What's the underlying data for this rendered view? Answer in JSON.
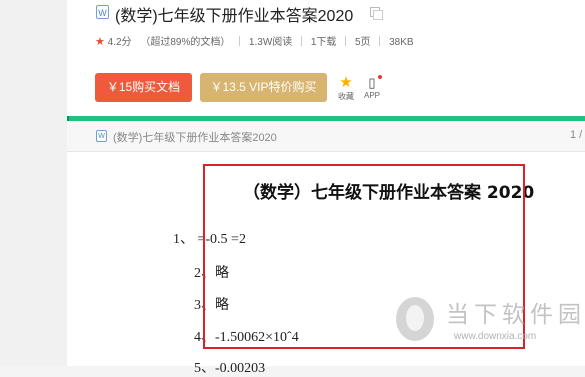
{
  "doc": {
    "icon_label": "W",
    "title": "(数学)七年级下册作业本答案2020",
    "rating": "4.2分",
    "beat": "（超过89%的文档）",
    "reads": "1.3W阅读",
    "downloads": "1下载",
    "pages": "5页",
    "size": "38KB"
  },
  "actions": {
    "buy_label": "￥15购买文档",
    "vip_label": "￥13.5 VIP特价购买",
    "fav_label": "收藏",
    "app_label": "APP"
  },
  "viewer": {
    "header_title": "(数学)七年级下册作业本答案2020",
    "page_num": "1 /"
  },
  "content": {
    "title": "（数学）七年级下册作业本答案 2020",
    "lines": [
      "1、 =-0.5 =2",
      "2、略",
      "3、略",
      "4、-1.50062×10ˆ4",
      "5、-0.00203"
    ]
  },
  "watermark": {
    "text": "当下软件园",
    "url": "www.downxia.com"
  },
  "colors": {
    "buy": "#f05a3c",
    "vip": "#d7b46f",
    "progress": "#20c080",
    "highlight": "#d7232b"
  }
}
